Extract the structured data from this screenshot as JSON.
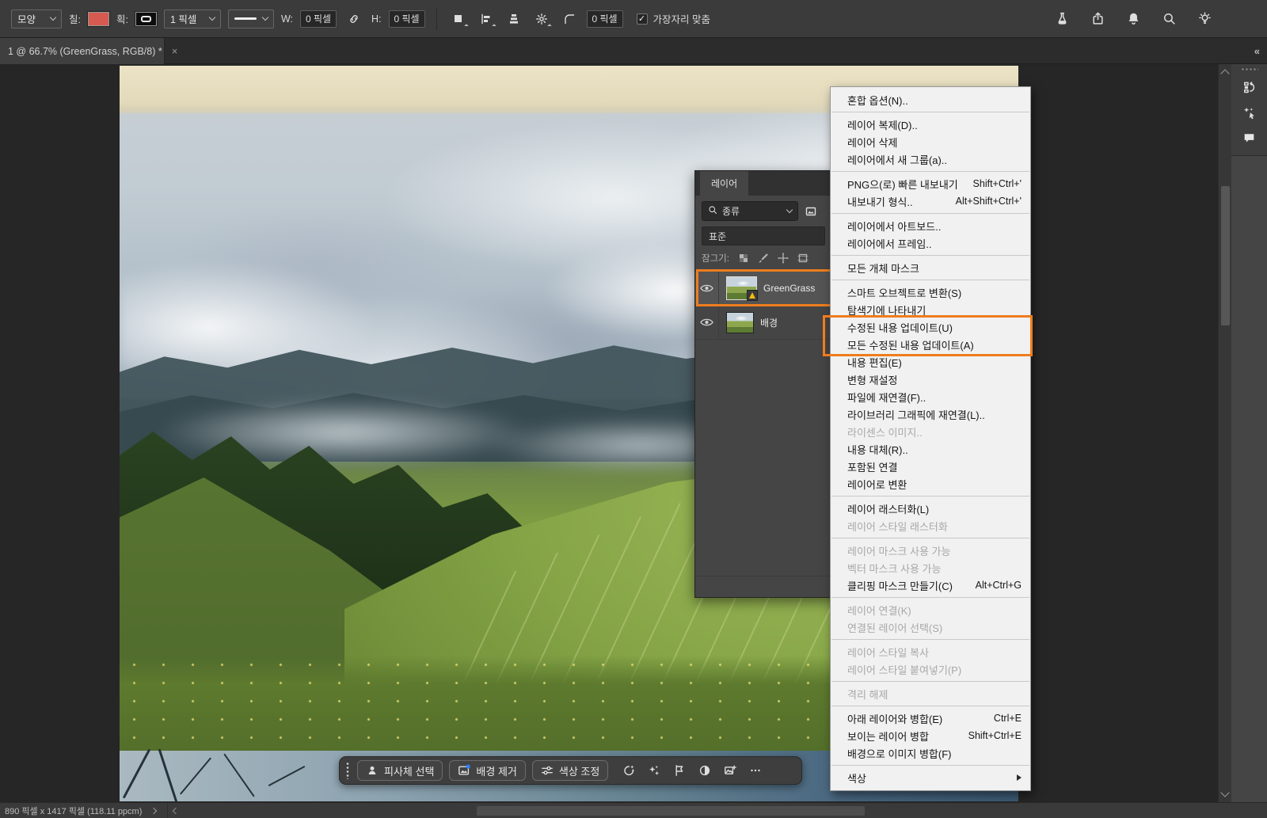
{
  "toolbar": {
    "mode": "모양",
    "fill_label": "칠:",
    "stroke_label": "획:",
    "stroke_width": "1 픽셀",
    "w_label": "W:",
    "w_value": "0 픽셀",
    "h_label": "H:",
    "h_value": "0 픽셀",
    "radius_value": "0 픽셀",
    "align_edges_label": "가장자리 맞춤",
    "right_icons": [
      "beaker-icon",
      "share-icon",
      "bell-icon",
      "search-icon",
      "lightbulb-icon"
    ]
  },
  "tab": {
    "title": "1 @ 66.7% (GreenGrass, RGB/8) *",
    "close_glyph": "×"
  },
  "layers_panel": {
    "tab_label": "레이어",
    "filter_label": "종류",
    "blend_mode": "표준",
    "lock_label": "잠그기:",
    "lock_icons": [
      "transparency-lock-icon",
      "paint-lock-icon",
      "move-lock-icon",
      "artboard-lock-icon"
    ],
    "layers": [
      {
        "name": "GreenGrass",
        "selected": true,
        "warning": true
      },
      {
        "name": "배경",
        "selected": false,
        "warning": false
      }
    ]
  },
  "context_menu": {
    "items": [
      {
        "label": "혼합 옵션(N).."
      },
      {
        "sep": true
      },
      {
        "label": "레이어 복제(D).."
      },
      {
        "label": "레이어 삭제"
      },
      {
        "label": "레이어에서 새 그룹(a).."
      },
      {
        "sep": true
      },
      {
        "label": "PNG으(로) 빠른 내보내기",
        "shortcut": "Shift+Ctrl+'"
      },
      {
        "label": "내보내기 형식..",
        "shortcut": "Alt+Shift+Ctrl+'"
      },
      {
        "sep": true
      },
      {
        "label": "레이어에서 아트보드.."
      },
      {
        "label": "레이어에서 프레임.."
      },
      {
        "sep": true
      },
      {
        "label": "모든 개체 마스크"
      },
      {
        "sep": true
      },
      {
        "label": "스마트 오브젝트로 변환(S)"
      },
      {
        "label": "탐색기에 나타내기"
      },
      {
        "label": "수정된 내용 업데이트(U)",
        "highlighted": true
      },
      {
        "label": "모든 수정된 내용 업데이트(A)",
        "highlighted": true
      },
      {
        "label": "내용 편집(E)"
      },
      {
        "label": "변형 재설정"
      },
      {
        "label": "파일에 재연결(F).."
      },
      {
        "label": "라이브러리 그래픽에 재연결(L).."
      },
      {
        "label": "라이센스 이미지..",
        "disabled": true
      },
      {
        "label": "내용 대체(R).."
      },
      {
        "label": "포함된 연결"
      },
      {
        "label": "레이어로 변환"
      },
      {
        "sep": true
      },
      {
        "label": "레이어 래스터화(L)"
      },
      {
        "label": "레이어 스타일 래스터화",
        "disabled": true
      },
      {
        "sep": true
      },
      {
        "label": "레이어 마스크 사용 가능",
        "disabled": true
      },
      {
        "label": "벡터 마스크 사용 가능",
        "disabled": true
      },
      {
        "label": "클리핑 마스크 만들기(C)",
        "shortcut": "Alt+Ctrl+G"
      },
      {
        "sep": true
      },
      {
        "label": "레이어 연결(K)",
        "disabled": true
      },
      {
        "label": "연결된 레이어 선택(S)",
        "disabled": true
      },
      {
        "sep": true
      },
      {
        "label": "레이어 스타일 복사",
        "disabled": true
      },
      {
        "label": "레이어 스타일 붙여넣기(P)",
        "disabled": true
      },
      {
        "sep": true
      },
      {
        "label": "격리 해제",
        "disabled": true
      },
      {
        "sep": true
      },
      {
        "label": "아래 레이어와 병합(E)",
        "shortcut": "Ctrl+E"
      },
      {
        "label": "보이는 레이어 병합",
        "shortcut": "Shift+Ctrl+E"
      },
      {
        "label": "배경으로 이미지 병합(F)"
      },
      {
        "sep": true
      },
      {
        "label": "색상",
        "submenu": true
      }
    ]
  },
  "taskbar": {
    "buttons": [
      {
        "label": "피사체 선택",
        "icon": "select-subject-icon"
      },
      {
        "label": "배경 제거",
        "icon": "remove-background-icon"
      },
      {
        "label": "색상 조정",
        "icon": "adjust-colors-icon"
      }
    ],
    "icon_buttons": [
      "generative-icon",
      "enhance-icon",
      "transform-icon",
      "contrast-icon",
      "add-image-icon",
      "more-icon"
    ]
  },
  "right_rail": {
    "collapse_glyph": "«",
    "icons": [
      "history-icon",
      "ai-tools-icon",
      "comments-icon"
    ]
  },
  "status_bar": {
    "dimensions": "890 픽셀 x 1417 픽셀 (118.11 ppcm)"
  },
  "colors": {
    "annotation_orange": "#ee7d1e",
    "fill_swatch_red": "#d75a50",
    "notification_blue": "#2d7ff9"
  }
}
